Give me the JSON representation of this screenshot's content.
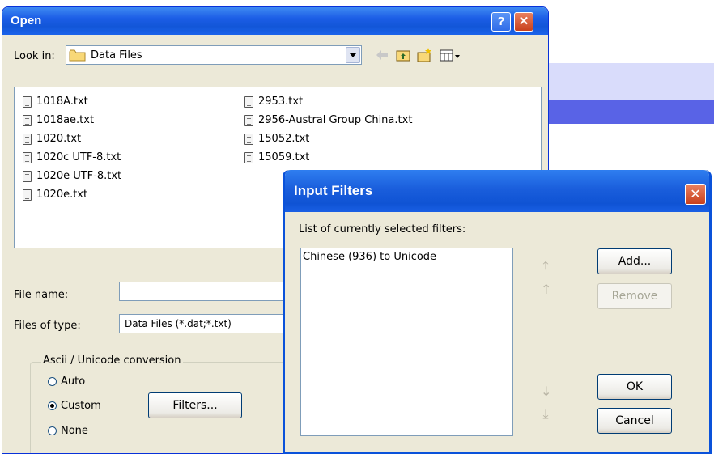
{
  "open_dialog": {
    "title": "Open",
    "look_in_label": "Look in:",
    "look_in_value": "Data Files",
    "files": [
      "1018A.txt",
      "1018ae.txt",
      "1020.txt",
      "1020c UTF-8.txt",
      "1020e UTF-8.txt",
      "1020e.txt",
      "2953.txt",
      "2956-Austral Group China.txt",
      "15052.txt",
      "15059.txt"
    ],
    "file_name_label": "File name:",
    "file_name_value": "",
    "files_of_type_label": "Files of type:",
    "files_of_type_value": "Data Files (*.dat;*.txt)",
    "conversion_group": {
      "legend": "Ascii / Unicode conversion",
      "options": [
        "Auto",
        "Custom",
        "None"
      ],
      "selected": "Custom",
      "filters_button": "Filters..."
    },
    "title_buttons": {
      "help": "?",
      "close": "✕"
    }
  },
  "input_filters_dialog": {
    "title": "Input Filters",
    "list_label": "List of currently selected filters:",
    "filters": [
      "Chinese (936) to Unicode"
    ],
    "buttons": {
      "add": "Add...",
      "remove": "Remove",
      "ok": "OK",
      "cancel": "Cancel"
    },
    "close_glyph": "✕"
  },
  "colors": {
    "xp_title_blue": "#1256d8",
    "dialog_face": "#ece9d8",
    "band_light": "#d9dcfb",
    "band_dark": "#5963e6"
  },
  "icons": [
    "folder-icon",
    "back-arrow-icon",
    "up-folder-icon",
    "new-folder-icon",
    "views-menu-icon",
    "text-file-icon",
    "move-top-icon",
    "move-up-icon",
    "move-down-icon",
    "move-bottom-icon"
  ]
}
